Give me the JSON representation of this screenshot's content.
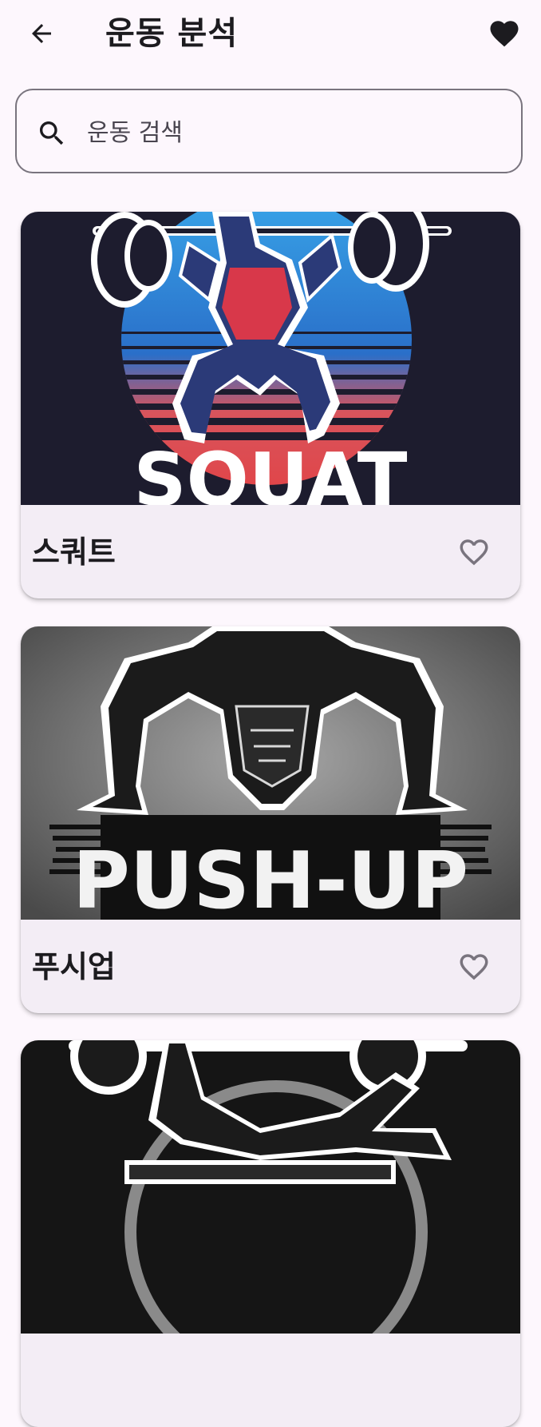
{
  "header": {
    "title": "운동 분석",
    "back_icon": "arrow-back-icon",
    "favorite_icon": "heart-filled-icon"
  },
  "search": {
    "placeholder": "운동 검색",
    "value": "",
    "icon": "search-icon"
  },
  "exercises": [
    {
      "name": "스쿼트",
      "image_text": "SQUAT",
      "favorite": false,
      "favorite_icon": "heart-outline-icon"
    },
    {
      "name": "푸시업",
      "image_text": "PUSH-UP",
      "favorite": false,
      "favorite_icon": "heart-outline-icon"
    },
    {
      "name": "",
      "image_text": "",
      "favorite": false
    }
  ],
  "colors": {
    "background": "#fdf7fd",
    "card": "#f3edf5",
    "outline": "#79747e",
    "text": "#1c1b1f",
    "icon_muted": "#79747e"
  }
}
